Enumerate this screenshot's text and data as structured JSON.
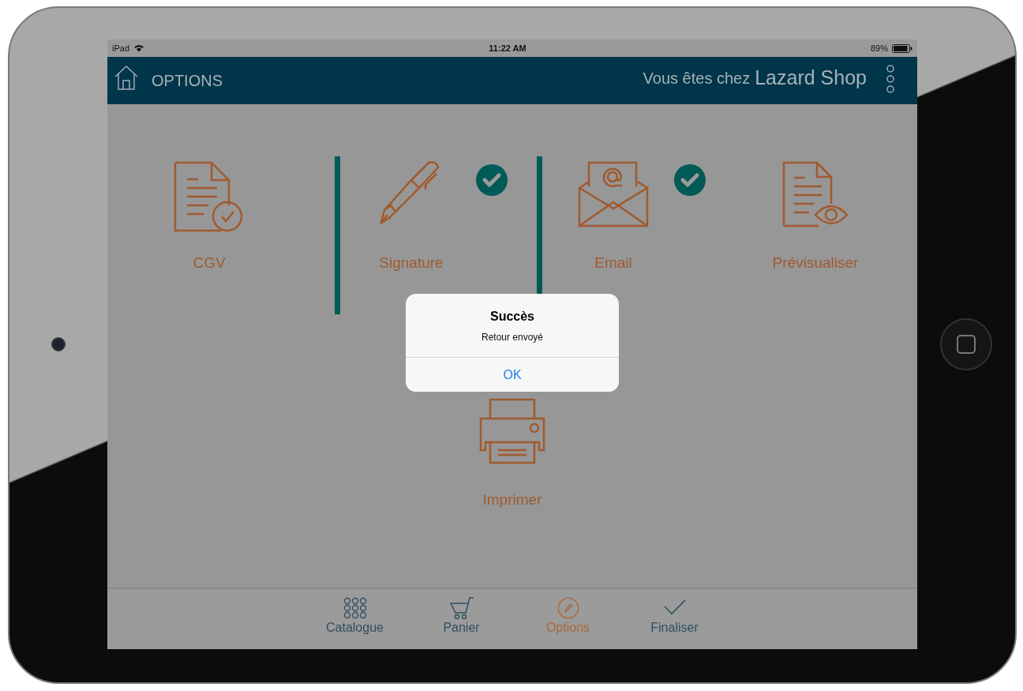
{
  "status_bar": {
    "device": "iPad",
    "time": "11:22 AM",
    "battery": "89%"
  },
  "header": {
    "title": "OPTIONS",
    "greeting": "Vous êtes chez",
    "shop": "Lazard Shop"
  },
  "options": [
    {
      "kind": "cgv",
      "label": "CGV",
      "done": false
    },
    {
      "kind": "signature",
      "label": "Signature",
      "done": true
    },
    {
      "kind": "email",
      "label": "Email",
      "done": true
    },
    {
      "kind": "preview",
      "label": "Prévisualiser",
      "done": false
    },
    {
      "kind": "print",
      "label": "Imprimer",
      "done": false
    }
  ],
  "alert": {
    "title": "Succès",
    "message": "Retour envoyé",
    "button": "OK"
  },
  "tab_bar": [
    {
      "kind": "catalogue",
      "label": "Catalogue",
      "selected": false
    },
    {
      "kind": "cart",
      "label": "Panier",
      "selected": false
    },
    {
      "kind": "options",
      "label": "Options",
      "selected": true
    },
    {
      "kind": "finalize",
      "label": "Finaliser",
      "selected": false
    }
  ]
}
